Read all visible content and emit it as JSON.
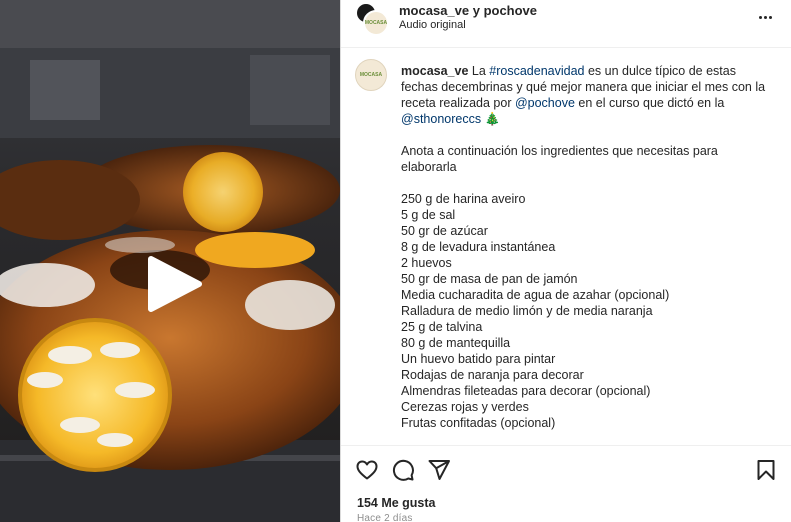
{
  "header": {
    "username": "mocasa_ve y pochove",
    "audio": "Audio original",
    "more_icon": "more-horizontal-icon",
    "avatar_logo_text": "MOCASA"
  },
  "caption": {
    "username": "mocasa_ve",
    "intro_1": " La ",
    "hashtag": "#roscadenavidad",
    "intro_2": " es un dulce típico de estas fechas decembrinas y qué mejor manera que iniciar el mes con la receta realizada por ",
    "mention_1": "@pochove",
    "intro_3": " en el curso que dictó en la ",
    "mention_2": "@sthonoreccs",
    "intro_emoji": "🎄",
    "paragraph_2": "Anota a continuación los ingredientes que necesitas para elaborarla",
    "ingredients": [
      "250 g de harina aveiro",
      "5 g de sal",
      "50 gr de azúcar",
      "8 g de levadura instantánea",
      "2 huevos",
      "50 gr de masa de pan de jamón",
      "Media cucharadita de agua de azahar (opcional)",
      "Ralladura de medio limón y de media naranja",
      "25 g de talvina",
      "80 g de mantequilla",
      "Un huevo batido para pintar",
      "Rodajas de naranja para decorar",
      "Almendras fileteadas para decorar (opcional)",
      "Cerezas rojas y verdes",
      "Frutas confitadas (opcional)"
    ]
  },
  "actions": {
    "like_icon": "heart-icon",
    "comment_icon": "comment-icon",
    "share_icon": "send-icon",
    "save_icon": "bookmark-icon"
  },
  "stats": {
    "likes": "154 Me gusta",
    "time": "Hace 2 días"
  },
  "media": {
    "play_icon": "play-icon"
  }
}
